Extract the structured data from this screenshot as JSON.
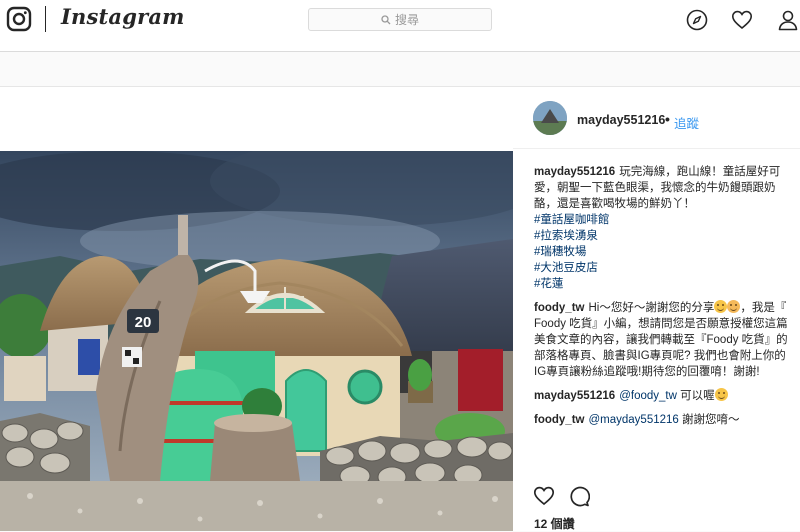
{
  "header": {
    "brand": "Instagram",
    "search": {
      "placeholder": "搜尋"
    },
    "icons": [
      "instagram-camera-icon",
      "compass-icon",
      "heart-icon",
      "user-icon"
    ]
  },
  "post": {
    "author": {
      "username": "mayday551216",
      "separator": "•",
      "follow_label": "追蹤"
    },
    "photo": {
      "house_sign": "20"
    },
    "caption": {
      "username": "mayday551216",
      "text": "玩完海線，跑山線！童話屋好可愛，朝聖一下藍色眼渠，我懷念的牛奶饅頭跟奶酪，還是喜歡喝牧場的鮮奶丫！",
      "hashtags": [
        "#童話屋咖啡館",
        "#拉索埃湧泉",
        "#瑞穗牧場",
        "#大池豆皮店",
        "#花蓮"
      ]
    },
    "comments": [
      {
        "username": "foody_tw",
        "text_1": "Hi～您好～謝謝您的分享",
        "text_2": "，我是『 Foody 吃貨』小編，想請問您是否願意授權您這篇美食文章的內容，讓我們轉載至『Foody 吃貨』的部落格專頁、臉書與IG專頁呢? 我們也會附上你的IG專頁讓粉絲追蹤哦!期待您的回覆唷！謝謝!"
      },
      {
        "username": "mayday551216",
        "mention": "@foody_tw",
        "text": "可以喔"
      },
      {
        "username": "foody_tw",
        "mention": "@mayday551216",
        "text": "謝謝您唷～"
      }
    ],
    "likes": "12 個讚",
    "colors": {
      "link_blue": "#3897f0",
      "hashtag_blue": "#003569",
      "text": "#262626",
      "border": "#dbdbdb"
    }
  }
}
